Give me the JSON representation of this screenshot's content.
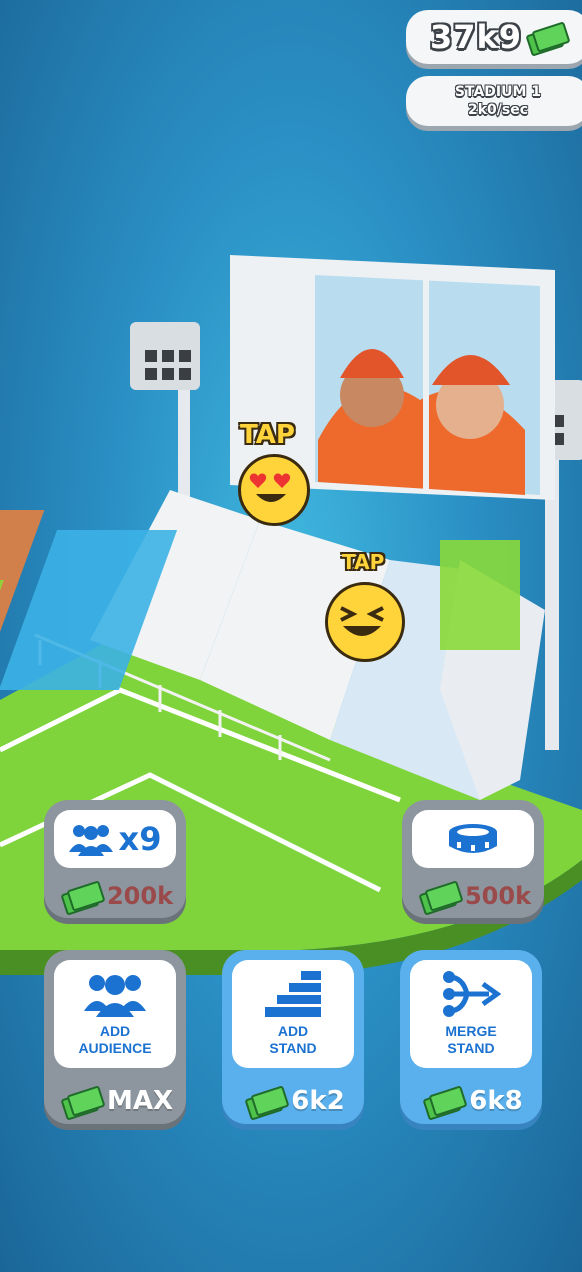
{
  "hud": {
    "money": "37k9",
    "stadium_name": "STADIUM 1",
    "income_rate": "2k0/sec"
  },
  "tap_labels": [
    "TAP",
    "TAP"
  ],
  "upgrades": {
    "audience_multiplier": {
      "label": "x9",
      "cost": "200k",
      "icon": "people-icon"
    },
    "stadium_upgrade": {
      "cost": "500k",
      "icon": "stadium-icon"
    }
  },
  "actions": [
    {
      "label_line1": "ADD",
      "label_line2": "AUDIENCE",
      "cost": "MAX",
      "icon": "people-icon"
    },
    {
      "label_line1": "ADD",
      "label_line2": "STAND",
      "cost": "6k2",
      "icon": "stairs-icon"
    },
    {
      "label_line1": "MERGE",
      "label_line2": "STAND",
      "cost": "6k8",
      "icon": "merge-icon"
    }
  ],
  "colors": {
    "accent_blue": "#1b72d0",
    "button_active": "#5ab0ec",
    "button_disabled": "#8d969e",
    "grass": "#7ed43a",
    "cash_green": "#4fc24a"
  }
}
